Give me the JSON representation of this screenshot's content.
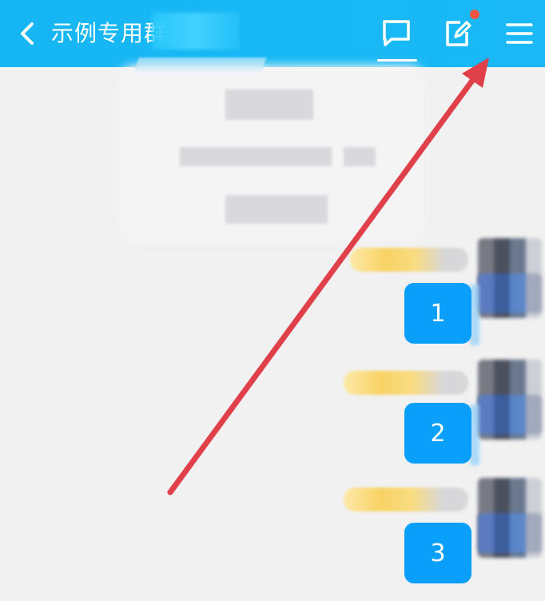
{
  "header": {
    "title": "示例专用群",
    "back_icon": "chevron-left-icon",
    "chat_icon": "message-square-icon",
    "edit_icon": "edit-square-icon",
    "menu_icon": "hamburger-menu-icon",
    "badge_color": "#f25643",
    "bar_color": "#17b8f5"
  },
  "messages": [
    {
      "text": "1"
    },
    {
      "text": "2"
    },
    {
      "text": "3"
    }
  ],
  "annotation": {
    "type": "arrow",
    "color": "#e0404a",
    "points_to": "hamburger-menu-icon"
  }
}
